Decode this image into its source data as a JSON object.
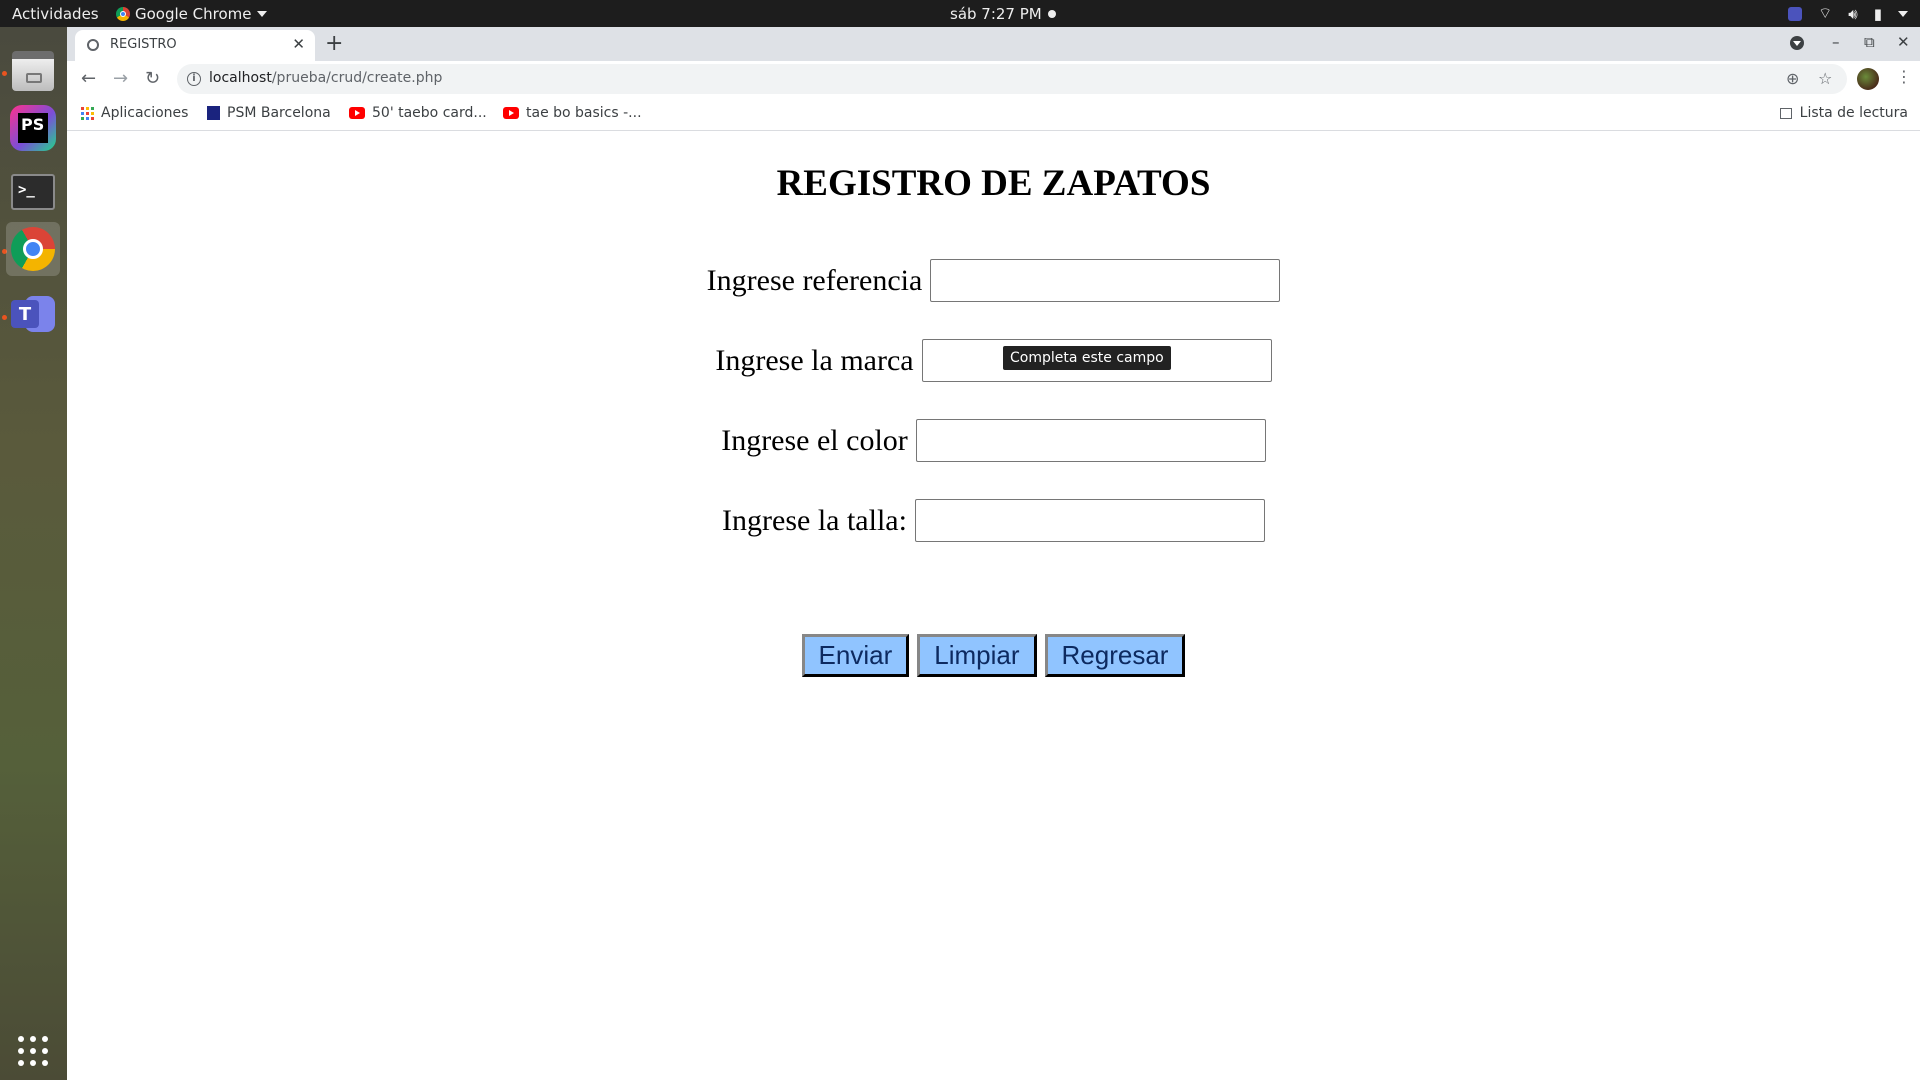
{
  "topbar": {
    "activities": "Actividades",
    "app_name": "Google Chrome",
    "clock": "sáb  7:27 PM"
  },
  "browser": {
    "tab_title": "REGISTRO",
    "url_host": "localhost",
    "url_path": "/prueba/crud/create.php",
    "bookmarks": {
      "apps": "Aplicaciones",
      "psm": "PSM Barcelona",
      "taebo1": "50' taebo card...",
      "taebo2": "tae bo basics -...",
      "reading_list": "Lista de lectura"
    }
  },
  "page": {
    "title": "REGISTRO DE ZAPATOS",
    "fields": [
      {
        "label": "Ingrese referencia",
        "value": ""
      },
      {
        "label": "Ingrese la marca",
        "value": ""
      },
      {
        "label": "Ingrese el color",
        "value": ""
      },
      {
        "label": "Ingrese la talla:",
        "value": ""
      }
    ],
    "tooltip": "Completa este campo",
    "buttons": {
      "submit": "Enviar",
      "clear": "Limpiar",
      "back": "Regresar"
    }
  },
  "colors": {
    "button_bg": "#90c4ff",
    "accent_dock": "#e95420"
  },
  "icons": [
    "files-icon",
    "phpstorm-icon",
    "terminal-icon",
    "chrome-icon",
    "teams-icon",
    "show-apps-icon"
  ]
}
